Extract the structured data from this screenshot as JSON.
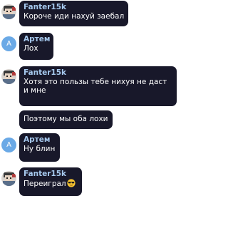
{
  "messages": [
    {
      "sender": "Fanter15k",
      "avatar_icon": "character-avatar-icon",
      "text": "Короче иди нахуй заебал"
    },
    {
      "sender": "Артем",
      "avatar_letter": "А",
      "text": "Лох"
    },
    {
      "sender": "Fanter15k",
      "avatar_icon": "character-avatar-icon",
      "text": "Хотя это пользы тебе нихуя не даст и мне"
    },
    {
      "text": "Поэтому мы оба лохи"
    },
    {
      "sender": "Артем",
      "avatar_letter": "А",
      "text": "Ну блин"
    },
    {
      "sender": "Fanter15k",
      "avatar_icon": "character-avatar-icon",
      "text": "Переиграл",
      "emoji": "sunglasses-emoji-icon"
    }
  ],
  "colors": {
    "bubble_bg": "#18182a",
    "sender_name": "#a6c9ee",
    "message_text": "#ffffff",
    "letter_avatar_bg": "#6aa9e6"
  }
}
